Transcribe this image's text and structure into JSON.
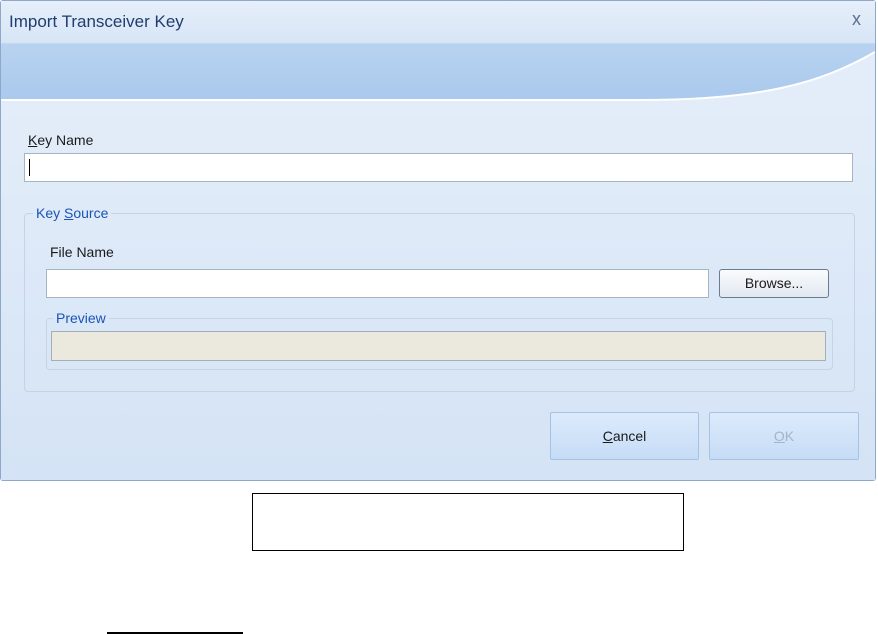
{
  "window": {
    "title": "Import Transceiver Key",
    "close_glyph": "x"
  },
  "key_name": {
    "label_mnemonic": "K",
    "label_rest": "ey Name",
    "value": ""
  },
  "key_source": {
    "legend_prefix": "Key ",
    "legend_mnemonic": "S",
    "legend_rest": "ource",
    "file_name_label": "File Name",
    "file_name_value": "",
    "browse_label": "Browse...",
    "preview_legend": "Preview",
    "preview_value": ""
  },
  "buttons": {
    "cancel_mnemonic": "C",
    "cancel_rest": "ancel",
    "ok_mnemonic": "O",
    "ok_rest": "K"
  },
  "colors": {
    "accent": "#1a54b5",
    "dialog_bg": "#dbe8f7",
    "preview_bg": "#ebe8dd"
  }
}
